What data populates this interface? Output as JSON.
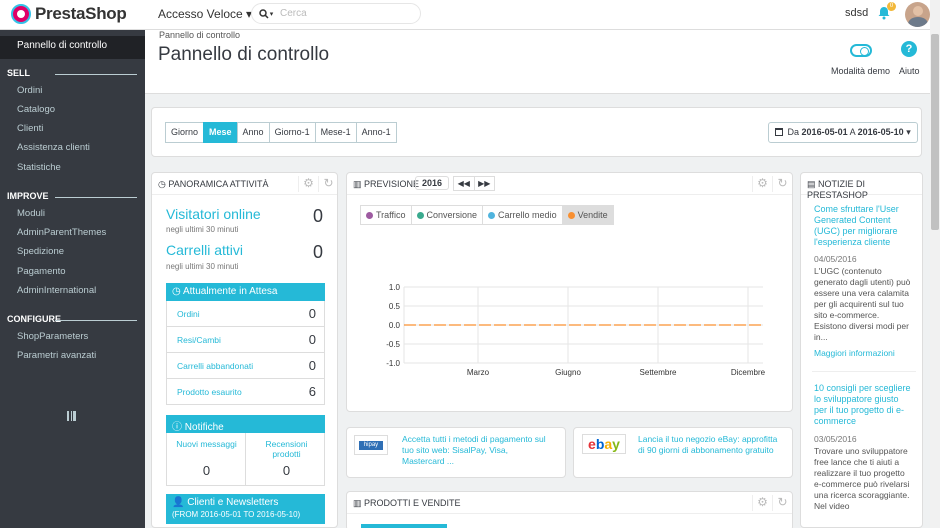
{
  "brand": {
    "logo_text": "PrestaShop",
    "accent": "#25b9d7",
    "primary": "#df0067"
  },
  "header": {
    "quick_access": "Accesso Veloce",
    "search_placeholder": "Cerca",
    "username": "sdsd",
    "notif_count": "0"
  },
  "sidebar": {
    "active": "Pannello di controllo",
    "sections": [
      {
        "title": "SELL",
        "items": [
          "Ordini",
          "Catalogo",
          "Clienti",
          "Assistenza clienti",
          "Statistiche"
        ]
      },
      {
        "title": "IMPROVE",
        "items": [
          "Moduli",
          "AdminParentThemes",
          "Spedizione",
          "Pagamento",
          "AdminInternational"
        ]
      },
      {
        "title": "CONFIGURE",
        "items": [
          "ShopParameters",
          "Parametri avanzati"
        ]
      }
    ]
  },
  "page": {
    "breadcrumb": "Pannello di controllo",
    "title": "Pannello di controllo",
    "demo_label": "Modalità demo",
    "help_label": "Aiuto"
  },
  "date_filter": {
    "buttons": [
      "Giorno",
      "Mese",
      "Anno",
      "Giorno-1",
      "Mese-1",
      "Anno-1"
    ],
    "active": "Mese",
    "range_from": "2016-05-01",
    "range_sep": "A",
    "range_to": "2016-05-10",
    "range_prefix": "Da"
  },
  "activity": {
    "title": "Panoramica attività",
    "visitors_label": "Visitatori online",
    "visitors_value": "0",
    "visitors_sub": "negli ultimi 30 minuti",
    "carts_label": "Carrelli attivi",
    "carts_value": "0",
    "carts_sub": "negli ultimi 30 minuti",
    "pending_title": "Attualmente in Attesa",
    "pending": [
      {
        "label": "Ordini",
        "value": "0"
      },
      {
        "label": "Resi/Cambi",
        "value": "0"
      },
      {
        "label": "Carrelli abbandonati",
        "value": "0"
      },
      {
        "label": "Prodotto esaurito",
        "value": "6"
      }
    ],
    "notif_title": "Notifiche",
    "notif_new_label": "Nuovi messaggi",
    "notif_new_value": "0",
    "notif_reviews_label": "Recensioni prodotti",
    "notif_reviews_value": "0",
    "clients_title": "Clienti e Newsletters",
    "clients_sub": "(FROM 2016-05-01 TO 2016-05-10)"
  },
  "forecast": {
    "title": "Previsione",
    "year": "2016",
    "legend": [
      {
        "name": "Traffico",
        "color": "#9e5ba1"
      },
      {
        "name": "Conversione",
        "color": "#3aaa8e"
      },
      {
        "name": "Carrello medio",
        "color": "#50b4de"
      },
      {
        "name": "Vendite",
        "color": "#f99031"
      }
    ],
    "active_legend": "Vendite"
  },
  "chart_data": {
    "type": "line",
    "categories": [
      "Marzo",
      "Giugno",
      "Settembre",
      "Dicembre"
    ],
    "y_ticks": [
      "1.0",
      "0.5",
      "0.0",
      "-0.5",
      "-1.0"
    ],
    "ylim": [
      -1,
      1
    ],
    "series": [
      {
        "name": "Vendite",
        "color": "#f99031",
        "values": [
          0,
          0,
          0,
          0
        ]
      }
    ],
    "grid": true
  },
  "promos": [
    {
      "logo": "hipay",
      "text": "Accetta tutti i metodi di pagamento sul tuo sito web: SisalPay, Visa, Mastercard ..."
    },
    {
      "logo": "ebay",
      "text": "Lancia il tuo negozio eBay: approfitta di 90 giorni di abbonamento gratuito"
    }
  ],
  "products": {
    "title": "Prodotti e vendite"
  },
  "news": {
    "title": "Notizie di PrestaShop",
    "items": [
      {
        "title": "Come sfruttare l'User Generated Content (UGC) per migliorare l'esperienza cliente",
        "date": "04/05/2016",
        "text": "L'UGC (contenuto generato dagli utenti) può essere una vera calamita per gli acquirenti sul tuo sito e-commerce. Esistono diversi modi per in...",
        "more": "Maggiori informazioni"
      },
      {
        "title": "10 consigli per scegliere lo sviluppatore giusto per il tuo progetto di e-commerce",
        "date": "03/05/2016",
        "text": "Trovare uno sviluppatore free lance che ti aiuti a realizzare il tuo progetto e-commerce può rivelarsi una ricerca scoraggiante. Nel video"
      }
    ]
  }
}
